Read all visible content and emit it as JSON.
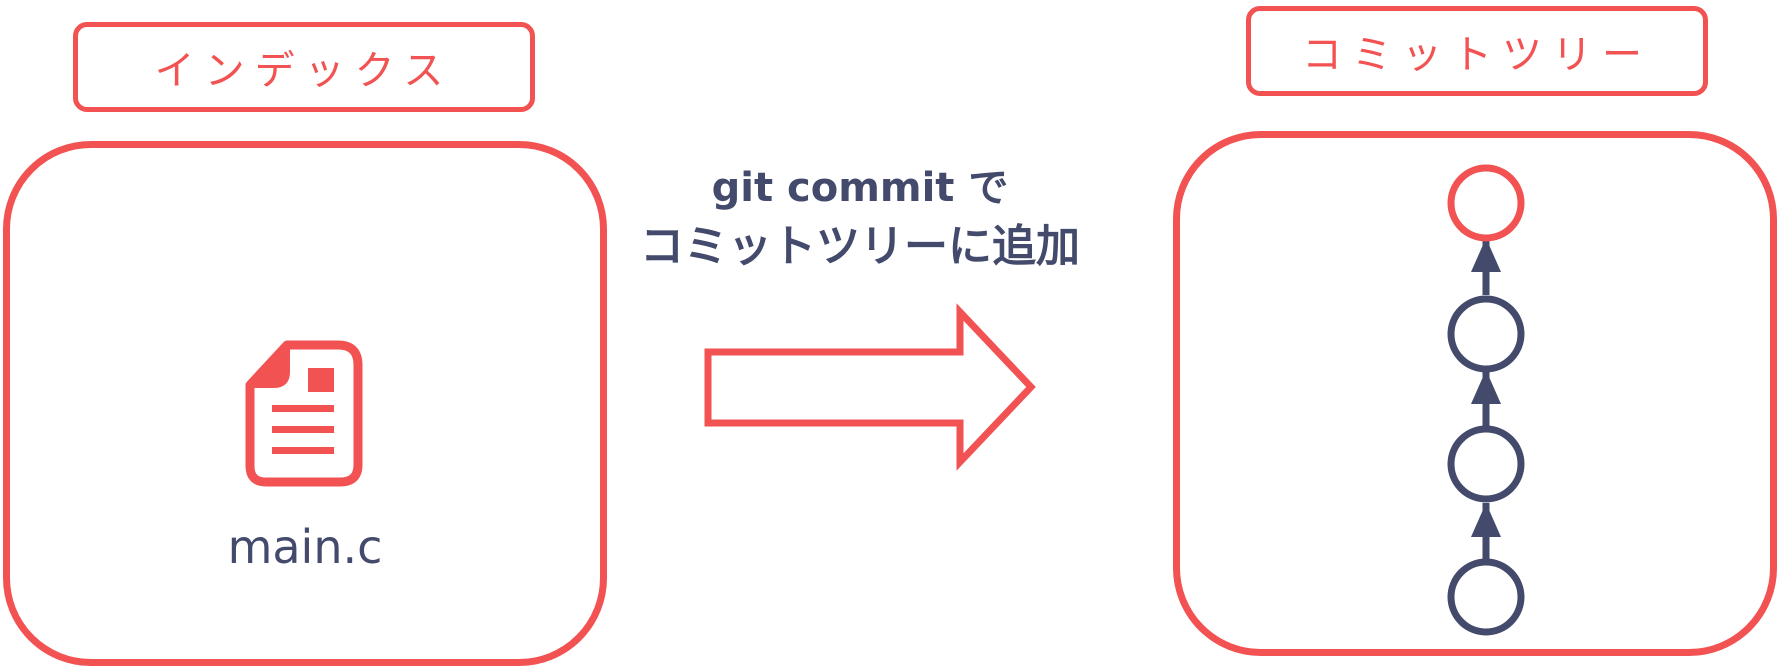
{
  "index": {
    "title": "インデックス",
    "file_name": "main.c",
    "file_icon": "document-icon"
  },
  "action": {
    "command": "git commit で",
    "description": "コミットツリーに追加",
    "arrow_icon": "right-arrow-icon"
  },
  "commit_tree": {
    "title": "コミットツリー",
    "commits": [
      {
        "state": "new"
      },
      {
        "state": "existing"
      },
      {
        "state": "existing"
      },
      {
        "state": "existing"
      }
    ]
  },
  "colors": {
    "accent": "#f25252",
    "ink": "#434a6b",
    "background": "#ffffff"
  }
}
